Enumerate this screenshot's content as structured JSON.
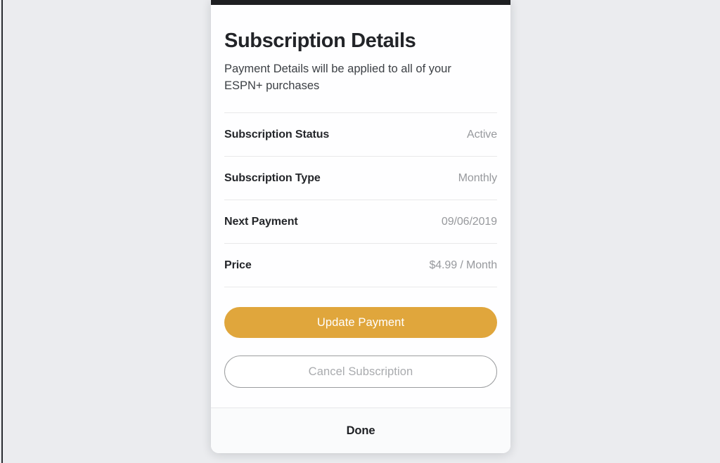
{
  "page": {
    "background_color": "#EBECEF"
  },
  "sheet": {
    "accent_bar_color": "#1E1F22",
    "title": "Subscription Details",
    "subtitle": "Payment Details will be applied to all of your ESPN+ purchases",
    "details": [
      {
        "label": "Subscription Status",
        "value": "Active"
      },
      {
        "label": "Subscription Type",
        "value": "Monthly"
      },
      {
        "label": "Next Payment",
        "value": "09/06/2019"
      },
      {
        "label": "Price",
        "value": "$4.99 / Month"
      }
    ],
    "actions": {
      "primary_label": "Update Payment",
      "primary_color": "#E0A63C",
      "secondary_label": "Cancel Subscription"
    },
    "footer": {
      "done_label": "Done"
    }
  }
}
